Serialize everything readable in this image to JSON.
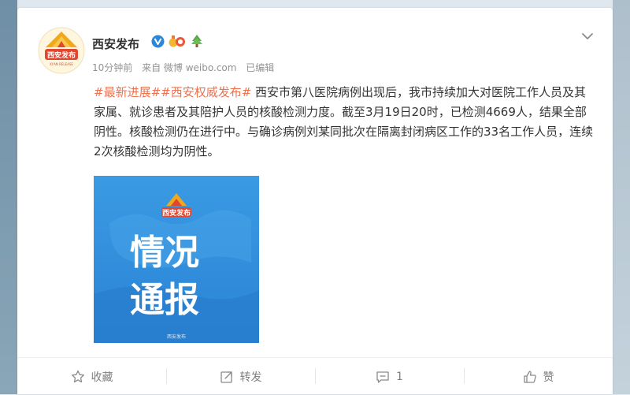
{
  "account": {
    "name": "西安发布",
    "avatar_text": "西安发布",
    "avatar_subtext": "XI'AN RELEASE"
  },
  "post": {
    "time": "10分钟前",
    "source": "来自 微博 weibo.com",
    "edited": "已编辑",
    "topic1": "#最新进展#",
    "topic2": "#西安权威发布#",
    "body": " 西安市第八医院病例出现后，我市持续加大对医院工作人员及其家属、就诊患者及其陪护人员的核酸检测力度。截至3月19日20时，已检测4669人，结果全部阴性。核酸检测仍在进行中。与确诊病例刘某同批次在隔离封闭病区工作的33名工作人员，连续2次核酸检测均为阴性。"
  },
  "image": {
    "logo_text": "西安发布",
    "line1": "情况",
    "line2": "通报",
    "watermark": "西安发布"
  },
  "actions": {
    "favorite": "收藏",
    "repost": "转发",
    "comment_count": "1",
    "like": "赞"
  },
  "colors": {
    "topic": "#eb7350",
    "verified": "#2a87db",
    "image_bg": "#2f8fdc"
  }
}
